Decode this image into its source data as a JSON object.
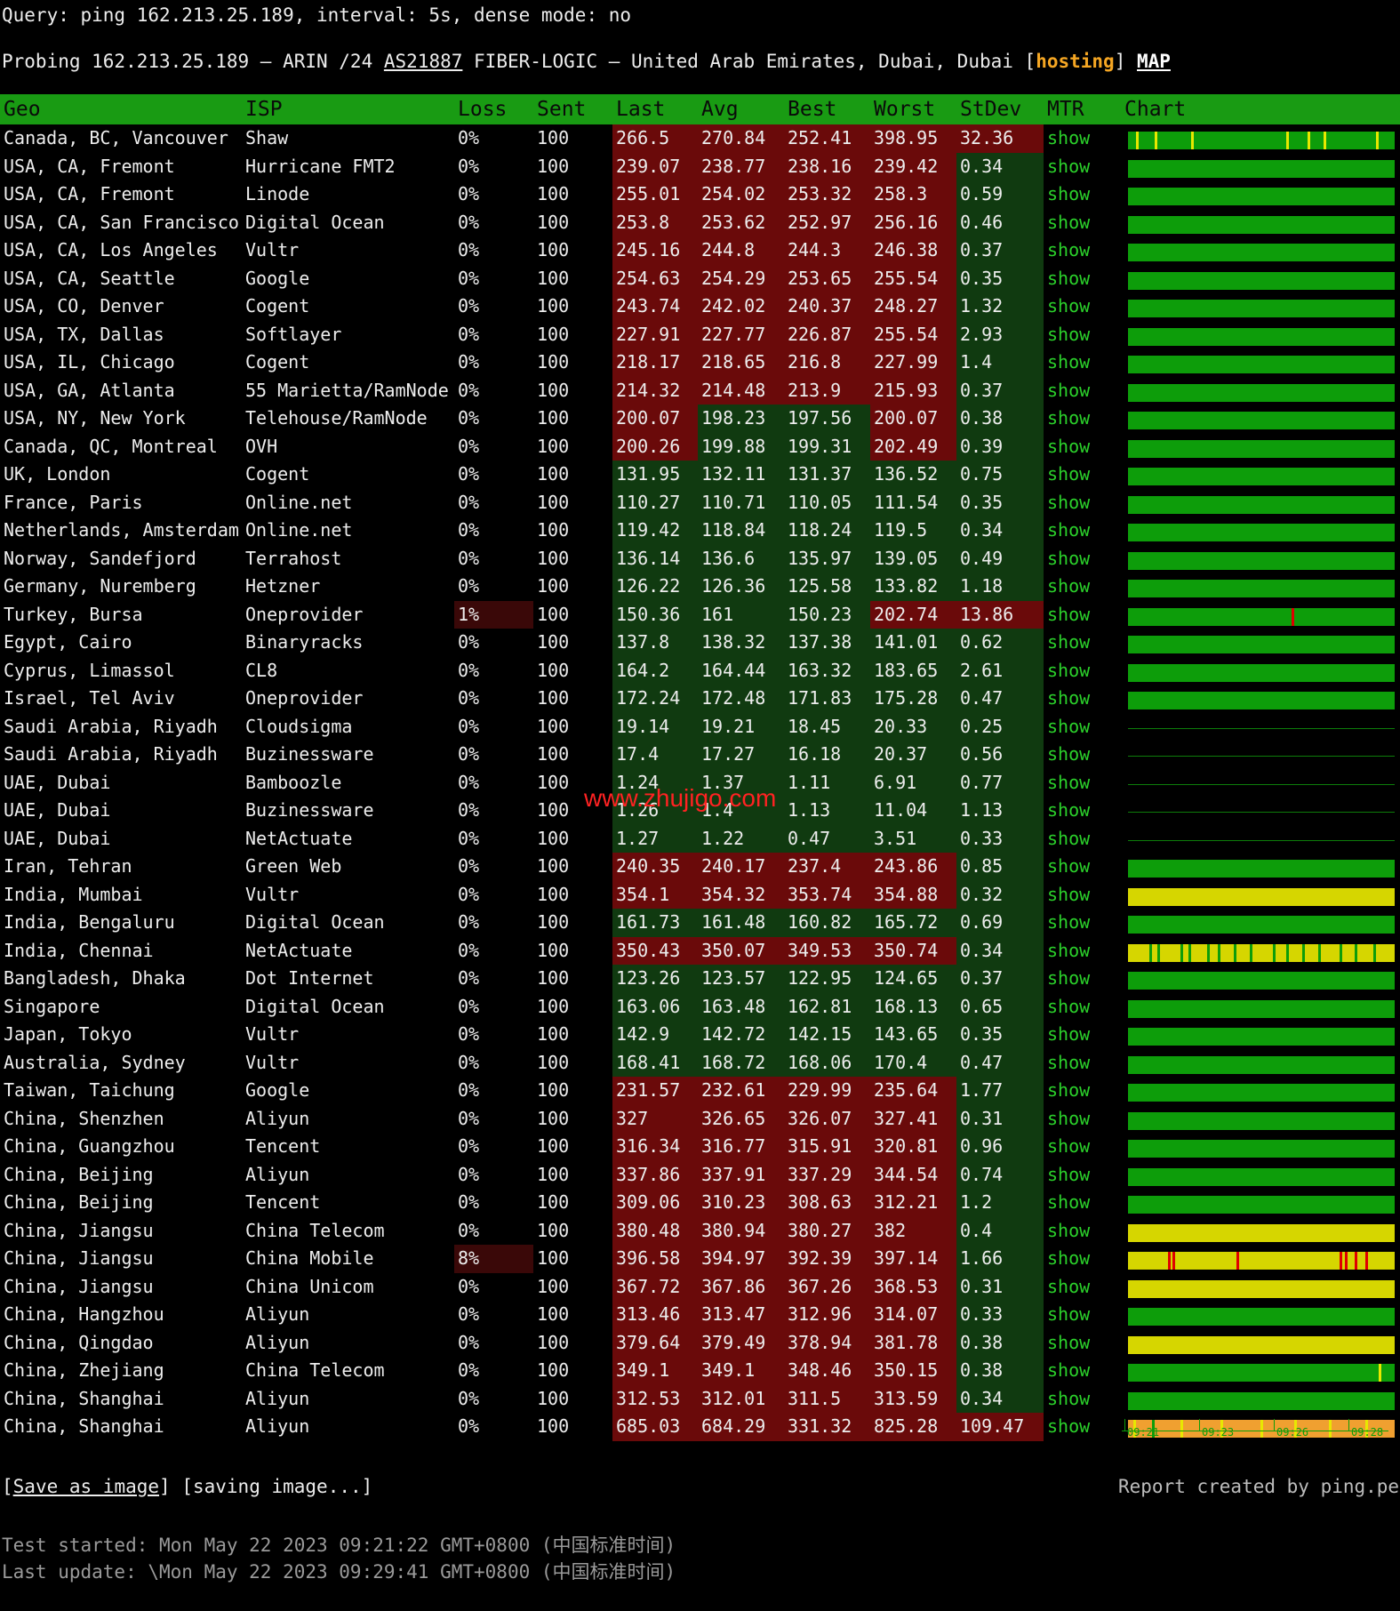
{
  "query": "Query: ping 162.213.25.189, interval: 5s, dense mode: no",
  "probe": {
    "prefix": "Probing 162.213.25.189 – ARIN /24 ",
    "asn": "AS21887",
    "middle": " FIBER-LOGIC – United Arab Emirates, Dubai, Dubai [",
    "tag": "hosting",
    "suffix": "] ",
    "map": "MAP"
  },
  "columns": [
    "Geo",
    "ISP",
    "Loss",
    "Sent",
    "Last",
    "Avg",
    "Best",
    "Worst",
    "StDev",
    "MTR",
    "Chart"
  ],
  "rows": [
    {
      "geo": "Canada, BC, Vancouver",
      "isp": "Shaw",
      "loss": "0%",
      "sent": "100",
      "last": "266.5",
      "avg": "270.84",
      "best": "252.41",
      "worst": "398.95",
      "stdev": "32.36",
      "mtr": "show",
      "bar": "green",
      "ticks": [
        {
          "p": 0.03,
          "c": "y"
        },
        {
          "p": 0.1,
          "c": "y"
        },
        {
          "p": 0.24,
          "c": "y"
        },
        {
          "p": 0.6,
          "c": "y"
        },
        {
          "p": 0.68,
          "c": "y"
        },
        {
          "p": 0.74,
          "c": "y"
        },
        {
          "p": 0.94,
          "c": "y"
        }
      ]
    },
    {
      "geo": "USA, CA, Fremont",
      "isp": "Hurricane FMT2",
      "loss": "0%",
      "sent": "100",
      "last": "239.07",
      "avg": "238.77",
      "best": "238.16",
      "worst": "239.42",
      "stdev": "0.34",
      "mtr": "show",
      "bar": "green",
      "ticks": []
    },
    {
      "geo": "USA, CA, Fremont",
      "isp": "Linode",
      "loss": "0%",
      "sent": "100",
      "last": "255.01",
      "avg": "254.02",
      "best": "253.32",
      "worst": "258.3",
      "stdev": "0.59",
      "mtr": "show",
      "bar": "green",
      "ticks": []
    },
    {
      "geo": "USA, CA, San Francisco",
      "isp": "Digital Ocean",
      "loss": "0%",
      "sent": "100",
      "last": "253.8",
      "avg": "253.62",
      "best": "252.97",
      "worst": "256.16",
      "stdev": "0.46",
      "mtr": "show",
      "bar": "green",
      "ticks": []
    },
    {
      "geo": "USA, CA, Los Angeles",
      "isp": "Vultr",
      "loss": "0%",
      "sent": "100",
      "last": "245.16",
      "avg": "244.8",
      "best": "244.3",
      "worst": "246.38",
      "stdev": "0.37",
      "mtr": "show",
      "bar": "green",
      "ticks": []
    },
    {
      "geo": "USA, CA, Seattle",
      "isp": "Google",
      "loss": "0%",
      "sent": "100",
      "last": "254.63",
      "avg": "254.29",
      "best": "253.65",
      "worst": "255.54",
      "stdev": "0.35",
      "mtr": "show",
      "bar": "green",
      "ticks": []
    },
    {
      "geo": "USA, CO, Denver",
      "isp": "Cogent",
      "loss": "0%",
      "sent": "100",
      "last": "243.74",
      "avg": "242.02",
      "best": "240.37",
      "worst": "248.27",
      "stdev": "1.32",
      "mtr": "show",
      "bar": "green",
      "ticks": []
    },
    {
      "geo": "USA, TX, Dallas",
      "isp": "Softlayer",
      "loss": "0%",
      "sent": "100",
      "last": "227.91",
      "avg": "227.77",
      "best": "226.87",
      "worst": "255.54",
      "stdev": "2.93",
      "mtr": "show",
      "bar": "green",
      "ticks": []
    },
    {
      "geo": "USA, IL, Chicago",
      "isp": "Cogent",
      "loss": "0%",
      "sent": "100",
      "last": "218.17",
      "avg": "218.65",
      "best": "216.8",
      "worst": "227.99",
      "stdev": "1.4",
      "mtr": "show",
      "bar": "green",
      "ticks": []
    },
    {
      "geo": "USA, GA, Atlanta",
      "isp": "55 Marietta/RamNode",
      "loss": "0%",
      "sent": "100",
      "last": "214.32",
      "avg": "214.48",
      "best": "213.9",
      "worst": "215.93",
      "stdev": "0.37",
      "mtr": "show",
      "bar": "green",
      "ticks": []
    },
    {
      "geo": "USA, NY, New York",
      "isp": "Telehouse/RamNode",
      "loss": "0%",
      "sent": "100",
      "last": "200.07",
      "avg": "198.23",
      "best": "197.56",
      "worst": "200.07",
      "stdev": "0.38",
      "mtr": "show",
      "bar": "green",
      "ticks": []
    },
    {
      "geo": "Canada, QC, Montreal",
      "isp": "OVH",
      "loss": "0%",
      "sent": "100",
      "last": "200.26",
      "avg": "199.88",
      "best": "199.31",
      "worst": "202.49",
      "stdev": "0.39",
      "mtr": "show",
      "bar": "green",
      "ticks": []
    },
    {
      "geo": "UK, London",
      "isp": "Cogent",
      "loss": "0%",
      "sent": "100",
      "last": "131.95",
      "avg": "132.11",
      "best": "131.37",
      "worst": "136.52",
      "stdev": "0.75",
      "mtr": "show",
      "bar": "green",
      "ticks": []
    },
    {
      "geo": "France, Paris",
      "isp": "Online.net",
      "loss": "0%",
      "sent": "100",
      "last": "110.27",
      "avg": "110.71",
      "best": "110.05",
      "worst": "111.54",
      "stdev": "0.35",
      "mtr": "show",
      "bar": "green",
      "ticks": []
    },
    {
      "geo": "Netherlands, Amsterdam",
      "isp": "Online.net",
      "loss": "0%",
      "sent": "100",
      "last": "119.42",
      "avg": "118.84",
      "best": "118.24",
      "worst": "119.5",
      "stdev": "0.34",
      "mtr": "show",
      "bar": "green",
      "ticks": []
    },
    {
      "geo": "Norway, Sandefjord",
      "isp": "Terrahost",
      "loss": "0%",
      "sent": "100",
      "last": "136.14",
      "avg": "136.6",
      "best": "135.97",
      "worst": "139.05",
      "stdev": "0.49",
      "mtr": "show",
      "bar": "green",
      "ticks": []
    },
    {
      "geo": "Germany, Nuremberg",
      "isp": "Hetzner",
      "loss": "0%",
      "sent": "100",
      "last": "126.22",
      "avg": "126.36",
      "best": "125.58",
      "worst": "133.82",
      "stdev": "1.18",
      "mtr": "show",
      "bar": "green",
      "ticks": []
    },
    {
      "geo": "Turkey, Bursa",
      "isp": "Oneprovider",
      "loss": "1%",
      "sent": "100",
      "last": "150.36",
      "avg": "161",
      "best": "150.23",
      "worst": "202.74",
      "stdev": "13.86",
      "mtr": "show",
      "bar": "green",
      "ticks": [
        {
          "p": 0.62,
          "c": "r"
        }
      ]
    },
    {
      "geo": "Egypt, Cairo",
      "isp": "Binaryracks",
      "loss": "0%",
      "sent": "100",
      "last": "137.8",
      "avg": "138.32",
      "best": "137.38",
      "worst": "141.01",
      "stdev": "0.62",
      "mtr": "show",
      "bar": "green",
      "ticks": []
    },
    {
      "geo": "Cyprus, Limassol",
      "isp": "CL8",
      "loss": "0%",
      "sent": "100",
      "last": "164.2",
      "avg": "164.44",
      "best": "163.32",
      "worst": "183.65",
      "stdev": "2.61",
      "mtr": "show",
      "bar": "green",
      "ticks": []
    },
    {
      "geo": "Israel, Tel Aviv",
      "isp": "Oneprovider",
      "loss": "0%",
      "sent": "100",
      "last": "172.24",
      "avg": "172.48",
      "best": "171.83",
      "worst": "175.28",
      "stdev": "0.47",
      "mtr": "show",
      "bar": "green",
      "ticks": []
    },
    {
      "geo": "Saudi Arabia, Riyadh",
      "isp": "Cloudsigma",
      "loss": "0%",
      "sent": "100",
      "last": "19.14",
      "avg": "19.21",
      "best": "18.45",
      "worst": "20.33",
      "stdev": "0.25",
      "mtr": "show",
      "bar": "thin",
      "ticks": []
    },
    {
      "geo": "Saudi Arabia, Riyadh",
      "isp": "Buzinessware",
      "loss": "0%",
      "sent": "100",
      "last": "17.4",
      "avg": "17.27",
      "best": "16.18",
      "worst": "20.37",
      "stdev": "0.56",
      "mtr": "show",
      "bar": "thin",
      "ticks": []
    },
    {
      "geo": "UAE, Dubai",
      "isp": "Bamboozle",
      "loss": "0%",
      "sent": "100",
      "last": "1.24",
      "avg": "1.37",
      "best": "1.11",
      "worst": "6.91",
      "stdev": "0.77",
      "mtr": "show",
      "bar": "thin",
      "ticks": []
    },
    {
      "geo": "UAE, Dubai",
      "isp": "Buzinessware",
      "loss": "0%",
      "sent": "100",
      "last": "1.26",
      "avg": "1.4",
      "best": "1.13",
      "worst": "11.04",
      "stdev": "1.13",
      "mtr": "show",
      "bar": "thin",
      "ticks": []
    },
    {
      "geo": "UAE, Dubai",
      "isp": "NetActuate",
      "loss": "0%",
      "sent": "100",
      "last": "1.27",
      "avg": "1.22",
      "best": "0.47",
      "worst": "3.51",
      "stdev": "0.33",
      "mtr": "show",
      "bar": "thin",
      "ticks": []
    },
    {
      "geo": "Iran, Tehran",
      "isp": "Green Web",
      "loss": "0%",
      "sent": "100",
      "last": "240.35",
      "avg": "240.17",
      "best": "237.4",
      "worst": "243.86",
      "stdev": "0.85",
      "mtr": "show",
      "bar": "green",
      "ticks": []
    },
    {
      "geo": "India, Mumbai",
      "isp": "Vultr",
      "loss": "0%",
      "sent": "100",
      "last": "354.1",
      "avg": "354.32",
      "best": "353.74",
      "worst": "354.88",
      "stdev": "0.32",
      "mtr": "show",
      "bar": "yellow",
      "ticks": []
    },
    {
      "geo": "India, Bengaluru",
      "isp": "Digital Ocean",
      "loss": "0%",
      "sent": "100",
      "last": "161.73",
      "avg": "161.48",
      "best": "160.82",
      "worst": "165.72",
      "stdev": "0.69",
      "mtr": "show",
      "bar": "green",
      "ticks": []
    },
    {
      "geo": "India, Chennai",
      "isp": "NetActuate",
      "loss": "0%",
      "sent": "100",
      "last": "350.43",
      "avg": "350.07",
      "best": "349.53",
      "worst": "350.74",
      "stdev": "0.34",
      "mtr": "show",
      "bar": "yellow",
      "ticks": [
        {
          "p": 0.08,
          "c": "g"
        },
        {
          "p": 0.11,
          "c": "g"
        },
        {
          "p": 0.2,
          "c": "g"
        },
        {
          "p": 0.23,
          "c": "g"
        },
        {
          "p": 0.3,
          "c": "g"
        },
        {
          "p": 0.34,
          "c": "g"
        },
        {
          "p": 0.4,
          "c": "g"
        },
        {
          "p": 0.46,
          "c": "g"
        },
        {
          "p": 0.55,
          "c": "g"
        },
        {
          "p": 0.6,
          "c": "g"
        },
        {
          "p": 0.66,
          "c": "g"
        },
        {
          "p": 0.72,
          "c": "g"
        },
        {
          "p": 0.8,
          "c": "g"
        },
        {
          "p": 0.86,
          "c": "g"
        },
        {
          "p": 0.93,
          "c": "g"
        }
      ]
    },
    {
      "geo": "Bangladesh, Dhaka",
      "isp": "Dot Internet",
      "loss": "0%",
      "sent": "100",
      "last": "123.26",
      "avg": "123.57",
      "best": "122.95",
      "worst": "124.65",
      "stdev": "0.37",
      "mtr": "show",
      "bar": "green",
      "ticks": []
    },
    {
      "geo": "Singapore",
      "isp": "Digital Ocean",
      "loss": "0%",
      "sent": "100",
      "last": "163.06",
      "avg": "163.48",
      "best": "162.81",
      "worst": "168.13",
      "stdev": "0.65",
      "mtr": "show",
      "bar": "green",
      "ticks": []
    },
    {
      "geo": "Japan, Tokyo",
      "isp": "Vultr",
      "loss": "0%",
      "sent": "100",
      "last": "142.9",
      "avg": "142.72",
      "best": "142.15",
      "worst": "143.65",
      "stdev": "0.35",
      "mtr": "show",
      "bar": "green",
      "ticks": []
    },
    {
      "geo": "Australia, Sydney",
      "isp": "Vultr",
      "loss": "0%",
      "sent": "100",
      "last": "168.41",
      "avg": "168.72",
      "best": "168.06",
      "worst": "170.4",
      "stdev": "0.47",
      "mtr": "show",
      "bar": "green",
      "ticks": []
    },
    {
      "geo": "Taiwan, Taichung",
      "isp": "Google",
      "loss": "0%",
      "sent": "100",
      "last": "231.57",
      "avg": "232.61",
      "best": "229.99",
      "worst": "235.64",
      "stdev": "1.77",
      "mtr": "show",
      "bar": "green",
      "ticks": []
    },
    {
      "geo": "China, Shenzhen",
      "isp": "Aliyun",
      "loss": "0%",
      "sent": "100",
      "last": "327",
      "avg": "326.65",
      "best": "326.07",
      "worst": "327.41",
      "stdev": "0.31",
      "mtr": "show",
      "bar": "green",
      "ticks": []
    },
    {
      "geo": "China, Guangzhou",
      "isp": "Tencent",
      "loss": "0%",
      "sent": "100",
      "last": "316.34",
      "avg": "316.77",
      "best": "315.91",
      "worst": "320.81",
      "stdev": "0.96",
      "mtr": "show",
      "bar": "green",
      "ticks": []
    },
    {
      "geo": "China, Beijing",
      "isp": "Aliyun",
      "loss": "0%",
      "sent": "100",
      "last": "337.86",
      "avg": "337.91",
      "best": "337.29",
      "worst": "344.54",
      "stdev": "0.74",
      "mtr": "show",
      "bar": "green",
      "ticks": []
    },
    {
      "geo": "China, Beijing",
      "isp": "Tencent",
      "loss": "0%",
      "sent": "100",
      "last": "309.06",
      "avg": "310.23",
      "best": "308.63",
      "worst": "312.21",
      "stdev": "1.2",
      "mtr": "show",
      "bar": "green",
      "ticks": []
    },
    {
      "geo": "China, Jiangsu",
      "isp": "China Telecom",
      "loss": "0%",
      "sent": "100",
      "last": "380.48",
      "avg": "380.94",
      "best": "380.27",
      "worst": "382",
      "stdev": "0.4",
      "mtr": "show",
      "bar": "yellow",
      "ticks": []
    },
    {
      "geo": "China, Jiangsu",
      "isp": "China Mobile",
      "loss": "8%",
      "sent": "100",
      "last": "396.58",
      "avg": "394.97",
      "best": "392.39",
      "worst": "397.14",
      "stdev": "1.66",
      "mtr": "show",
      "bar": "yellow",
      "ticks": [
        {
          "p": 0.15,
          "c": "r"
        },
        {
          "p": 0.17,
          "c": "r"
        },
        {
          "p": 0.41,
          "c": "r"
        },
        {
          "p": 0.8,
          "c": "r"
        },
        {
          "p": 0.82,
          "c": "r"
        },
        {
          "p": 0.86,
          "c": "r"
        },
        {
          "p": 0.9,
          "c": "r"
        }
      ]
    },
    {
      "geo": "China, Jiangsu",
      "isp": "China Unicom",
      "loss": "0%",
      "sent": "100",
      "last": "367.72",
      "avg": "367.86",
      "best": "367.26",
      "worst": "368.53",
      "stdev": "0.31",
      "mtr": "show",
      "bar": "yellow",
      "ticks": []
    },
    {
      "geo": "China, Hangzhou",
      "isp": "Aliyun",
      "loss": "0%",
      "sent": "100",
      "last": "313.46",
      "avg": "313.47",
      "best": "312.96",
      "worst": "314.07",
      "stdev": "0.33",
      "mtr": "show",
      "bar": "green",
      "ticks": []
    },
    {
      "geo": "China, Qingdao",
      "isp": "Aliyun",
      "loss": "0%",
      "sent": "100",
      "last": "379.64",
      "avg": "379.49",
      "best": "378.94",
      "worst": "381.78",
      "stdev": "0.38",
      "mtr": "show",
      "bar": "yellow",
      "ticks": []
    },
    {
      "geo": "China, Zhejiang",
      "isp": "China Telecom",
      "loss": "0%",
      "sent": "100",
      "last": "349.1",
      "avg": "349.1",
      "best": "348.46",
      "worst": "350.15",
      "stdev": "0.38",
      "mtr": "show",
      "bar": "green",
      "ticks": [
        {
          "p": 0.95,
          "c": "y"
        }
      ]
    },
    {
      "geo": "China, Shanghai",
      "isp": "Aliyun",
      "loss": "0%",
      "sent": "100",
      "last": "312.53",
      "avg": "312.01",
      "best": "311.5",
      "worst": "313.59",
      "stdev": "0.34",
      "mtr": "show",
      "bar": "green",
      "ticks": []
    },
    {
      "geo": "China, Shanghai",
      "isp": "Aliyun",
      "loss": "0%",
      "sent": "100",
      "last": "685.03",
      "avg": "684.29",
      "best": "331.32",
      "worst": "825.28",
      "stdev": "109.47",
      "mtr": "show",
      "bar": "orange",
      "ticks": [
        {
          "p": 0.02,
          "c": "y"
        },
        {
          "p": 0.09,
          "c": "g"
        },
        {
          "p": 0.2,
          "c": "y"
        },
        {
          "p": 0.35,
          "c": "y"
        },
        {
          "p": 0.5,
          "c": "y"
        },
        {
          "p": 0.63,
          "c": "y"
        },
        {
          "p": 0.76,
          "c": "y"
        },
        {
          "p": 0.9,
          "c": "y"
        }
      ]
    }
  ],
  "axis_labels": [
    "09:21",
    "09:23",
    "09:26",
    "09:28"
  ],
  "footer": {
    "save_link": "Save as image",
    "save_status": " [saving image...]",
    "report": "Report created by ping.pe",
    "started": "Test started: Mon May 22 2023 09:21:22 GMT+0800 (中国标准时间)",
    "updated": "Last update: \\Mon May 22 2023 09:29:41 GMT+0800 (中国标准时间)"
  },
  "watermark": "www.zhujigo.com",
  "colors": {
    "header_bg": "#199b13",
    "mtr_link": "#2bd12b",
    "hosting_tag": "#f5a623",
    "cell_red": "#6a0a0a",
    "cell_green": "#103a10",
    "bar_green": "#0d9d0a",
    "bar_yellow": "#d6d600",
    "bar_orange": "#f0a030"
  }
}
